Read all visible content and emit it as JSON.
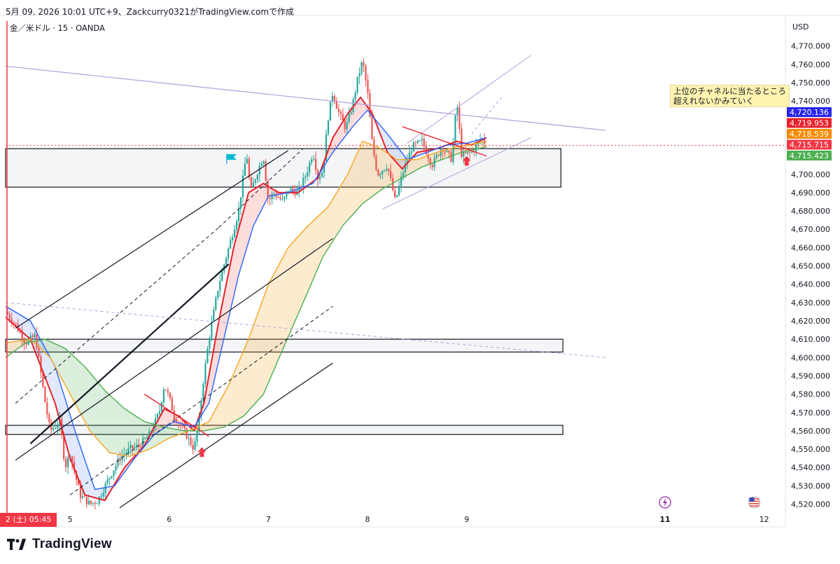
{
  "header": {
    "title": "5月 09, 2026 10:01 UTC+9、Zackcurry0321がTradingView.comで作成"
  },
  "symbol": {
    "label": "金／米ドル · 15 · OANDA"
  },
  "currency": "USD",
  "annotation": {
    "line1": "上位のチャネルに当たるところ",
    "line2": "超えれないかみていく"
  },
  "timeline_label": "2 (土)  05:45",
  "brand": {
    "name": "TradingView"
  },
  "colors": {
    "price_up": "#26a69a",
    "price_down": "#ef5350",
    "ma_red": "#e8212b",
    "ma_blue": "#2962ff",
    "ma_orange": "#f5a623",
    "ma_green": "#4caf50",
    "tag_blue": "#2a25e8",
    "tag_red": "#e8212b",
    "tag_orange": "#f58b00",
    "tag_pink": "#f23645",
    "tag_green": "#4caf50"
  },
  "chart_data": {
    "type": "line",
    "title": "金／米ドル · 15 · OANDA",
    "xlabel": "",
    "ylabel": "USD",
    "ylim": [
      4516,
      4776
    ],
    "xlim": [
      4.35,
      12.2
    ],
    "y_ticks": [
      {
        "v": 4520,
        "t": "4,520.000"
      },
      {
        "v": 4530,
        "t": "4,530.000"
      },
      {
        "v": 4540,
        "t": "4,540.000"
      },
      {
        "v": 4550,
        "t": "4,550.000"
      },
      {
        "v": 4560,
        "t": "4,560.000"
      },
      {
        "v": 4570,
        "t": "4,570.000"
      },
      {
        "v": 4580,
        "t": "4,580.000"
      },
      {
        "v": 4590,
        "t": "4,590.000"
      },
      {
        "v": 4600,
        "t": "4,600.000"
      },
      {
        "v": 4610,
        "t": "4,610.000"
      },
      {
        "v": 4620,
        "t": "4,620.000"
      },
      {
        "v": 4630,
        "t": "4,630.000"
      },
      {
        "v": 4640,
        "t": "4,640.000"
      },
      {
        "v": 4650,
        "t": "4,650.000"
      },
      {
        "v": 4660,
        "t": "4,660.000"
      },
      {
        "v": 4670,
        "t": "4,670.000"
      },
      {
        "v": 4680,
        "t": "4,680.000"
      },
      {
        "v": 4690,
        "t": "4,690.000"
      },
      {
        "v": 4700,
        "t": "4,700.000"
      },
      {
        "v": 4740,
        "t": "4,740.000"
      },
      {
        "v": 4750,
        "t": "4,750.000"
      },
      {
        "v": 4760,
        "t": "4,760.000"
      },
      {
        "v": 4770,
        "t": "4,770.000"
      }
    ],
    "x_ticks": [
      {
        "v": 5,
        "t": "5"
      },
      {
        "v": 6,
        "t": "6"
      },
      {
        "v": 7,
        "t": "7"
      },
      {
        "v": 8,
        "t": "8"
      },
      {
        "v": 9,
        "t": "9"
      },
      {
        "v": 11,
        "t": "11"
      },
      {
        "v": 12,
        "t": "12"
      }
    ],
    "price_tags": [
      {
        "v": 4720.136,
        "t": "4,720.136",
        "color": "#2a25e8"
      },
      {
        "v": 4719.953,
        "t": "4,719.953",
        "color": "#e8212b"
      },
      {
        "v": 4718.539,
        "t": "4,718.539",
        "color": "#f58b00"
      },
      {
        "v": 4715.715,
        "t": "4,715.715",
        "color": "#f23645"
      },
      {
        "v": 4715.423,
        "t": "4,715.423",
        "color": "#4caf50"
      }
    ],
    "price_path": [
      [
        4.35,
        4625
      ],
      [
        4.45,
        4618
      ],
      [
        4.55,
        4608
      ],
      [
        4.65,
        4612
      ],
      [
        4.75,
        4575
      ],
      [
        4.8,
        4560
      ],
      [
        4.9,
        4565
      ],
      [
        4.95,
        4540
      ],
      [
        5.0,
        4548
      ],
      [
        5.1,
        4525
      ],
      [
        5.2,
        4520
      ],
      [
        5.28,
        4522
      ],
      [
        5.4,
        4535
      ],
      [
        5.5,
        4545
      ],
      [
        5.6,
        4550
      ],
      [
        5.7,
        4552
      ],
      [
        5.8,
        4558
      ],
      [
        5.9,
        4570
      ],
      [
        5.95,
        4585
      ],
      [
        6.0,
        4578
      ],
      [
        6.05,
        4568
      ],
      [
        6.15,
        4560
      ],
      [
        6.25,
        4550
      ],
      [
        6.3,
        4565
      ],
      [
        6.35,
        4590
      ],
      [
        6.4,
        4610
      ],
      [
        6.45,
        4625
      ],
      [
        6.5,
        4640
      ],
      [
        6.55,
        4650
      ],
      [
        6.6,
        4660
      ],
      [
        6.65,
        4670
      ],
      [
        6.7,
        4680
      ],
      [
        6.75,
        4700
      ],
      [
        6.78,
        4712
      ],
      [
        6.82,
        4690
      ],
      [
        6.88,
        4700
      ],
      [
        6.95,
        4710
      ],
      [
        7.0,
        4685
      ],
      [
        7.05,
        4690
      ],
      [
        7.15,
        4685
      ],
      [
        7.2,
        4692
      ],
      [
        7.3,
        4690
      ],
      [
        7.38,
        4700
      ],
      [
        7.45,
        4712
      ],
      [
        7.5,
        4698
      ],
      [
        7.55,
        4702
      ],
      [
        7.6,
        4730
      ],
      [
        7.65,
        4745
      ],
      [
        7.7,
        4735
      ],
      [
        7.78,
        4725
      ],
      [
        7.85,
        4738
      ],
      [
        7.9,
        4752
      ],
      [
        7.95,
        4762
      ],
      [
        8.0,
        4745
      ],
      [
        8.05,
        4715
      ],
      [
        8.1,
        4700
      ],
      [
        8.2,
        4705
      ],
      [
        8.28,
        4685
      ],
      [
        8.35,
        4700
      ],
      [
        8.45,
        4715
      ],
      [
        8.55,
        4718
      ],
      [
        8.65,
        4705
      ],
      [
        8.75,
        4715
      ],
      [
        8.85,
        4708
      ],
      [
        8.9,
        4740
      ],
      [
        8.95,
        4710
      ],
      [
        9.05,
        4712
      ],
      [
        9.15,
        4720
      ],
      [
        9.2,
        4716
      ]
    ],
    "series": [
      {
        "name": "",
        "color": "#e8212b",
        "values": [
          [
            4.35,
            4622
          ],
          [
            4.6,
            4610
          ],
          [
            4.85,
            4575
          ],
          [
            5.0,
            4545
          ],
          [
            5.15,
            4525
          ],
          [
            5.35,
            4522
          ],
          [
            5.55,
            4540
          ],
          [
            5.75,
            4552
          ],
          [
            5.95,
            4572
          ],
          [
            6.1,
            4568
          ],
          [
            6.25,
            4560
          ],
          [
            6.35,
            4575
          ],
          [
            6.5,
            4620
          ],
          [
            6.65,
            4660
          ],
          [
            6.8,
            4690
          ],
          [
            6.95,
            4695
          ],
          [
            7.1,
            4690
          ],
          [
            7.3,
            4690
          ],
          [
            7.5,
            4698
          ],
          [
            7.65,
            4720
          ],
          [
            7.8,
            4733
          ],
          [
            7.93,
            4742
          ],
          [
            8.05,
            4733
          ],
          [
            8.2,
            4712
          ],
          [
            8.35,
            4703
          ],
          [
            8.5,
            4712
          ],
          [
            8.7,
            4714
          ],
          [
            8.9,
            4718
          ],
          [
            9.05,
            4716
          ],
          [
            9.2,
            4720
          ]
        ]
      },
      {
        "name": "",
        "color": "#2962ff",
        "values": [
          [
            4.35,
            4628
          ],
          [
            4.6,
            4620
          ],
          [
            4.85,
            4595
          ],
          [
            5.05,
            4560
          ],
          [
            5.25,
            4528
          ],
          [
            5.45,
            4530
          ],
          [
            5.65,
            4545
          ],
          [
            5.85,
            4558
          ],
          [
            6.05,
            4565
          ],
          [
            6.25,
            4562
          ],
          [
            6.4,
            4575
          ],
          [
            6.55,
            4610
          ],
          [
            6.7,
            4645
          ],
          [
            6.85,
            4672
          ],
          [
            7.0,
            4688
          ],
          [
            7.2,
            4690
          ],
          [
            7.45,
            4695
          ],
          [
            7.65,
            4712
          ],
          [
            7.85,
            4726
          ],
          [
            8.0,
            4735
          ],
          [
            8.2,
            4722
          ],
          [
            8.4,
            4708
          ],
          [
            8.6,
            4712
          ],
          [
            8.8,
            4716
          ],
          [
            9.0,
            4717
          ],
          [
            9.2,
            4720
          ]
        ]
      },
      {
        "name": "",
        "color": "#f5a623",
        "values": [
          [
            4.35,
            4608
          ],
          [
            4.6,
            4610
          ],
          [
            4.8,
            4600
          ],
          [
            5.0,
            4580
          ],
          [
            5.2,
            4560
          ],
          [
            5.4,
            4548
          ],
          [
            5.6,
            4546
          ],
          [
            5.8,
            4550
          ],
          [
            6.0,
            4556
          ],
          [
            6.2,
            4560
          ],
          [
            6.4,
            4565
          ],
          [
            6.6,
            4585
          ],
          [
            6.8,
            4610
          ],
          [
            7.0,
            4640
          ],
          [
            7.2,
            4660
          ],
          [
            7.4,
            4672
          ],
          [
            7.6,
            4682
          ],
          [
            7.8,
            4700
          ],
          [
            7.95,
            4718
          ],
          [
            8.1,
            4715
          ],
          [
            8.3,
            4708
          ],
          [
            8.5,
            4708
          ],
          [
            8.7,
            4712
          ],
          [
            8.9,
            4715
          ],
          [
            9.2,
            4718
          ]
        ]
      },
      {
        "name": "",
        "color": "#4caf50",
        "values": [
          [
            4.35,
            4600
          ],
          [
            4.55,
            4608
          ],
          [
            4.75,
            4610
          ],
          [
            4.95,
            4605
          ],
          [
            5.15,
            4595
          ],
          [
            5.35,
            4582
          ],
          [
            5.55,
            4572
          ],
          [
            5.75,
            4565
          ],
          [
            5.95,
            4562
          ],
          [
            6.15,
            4560
          ],
          [
            6.35,
            4560
          ],
          [
            6.55,
            4562
          ],
          [
            6.75,
            4568
          ],
          [
            6.95,
            4580
          ],
          [
            7.15,
            4605
          ],
          [
            7.35,
            4630
          ],
          [
            7.55,
            4655
          ],
          [
            7.75,
            4672
          ],
          [
            7.95,
            4684
          ],
          [
            8.15,
            4692
          ],
          [
            8.35,
            4698
          ],
          [
            8.55,
            4704
          ],
          [
            8.75,
            4708
          ],
          [
            8.95,
            4712
          ],
          [
            9.2,
            4715
          ]
        ]
      }
    ],
    "zones": [
      {
        "x1": 4.35,
        "x2": 9.95,
        "y1": 4693,
        "y2": 4714
      },
      {
        "x1": 4.35,
        "x2": 9.97,
        "y1": 4603,
        "y2": 4610
      },
      {
        "x1": 4.35,
        "x2": 9.97,
        "y1": 4558,
        "y2": 4563
      }
    ],
    "lines": [
      {
        "x1": 4.45,
        "y1": 4544,
        "x2": 7.65,
        "y2": 4665,
        "color": "#131722",
        "w": 1.2,
        "dash": ""
      },
      {
        "x1": 4.6,
        "y1": 4553,
        "x2": 6.6,
        "y2": 4651,
        "color": "#131722",
        "w": 2.2,
        "dash": ""
      },
      {
        "x1": 4.45,
        "y1": 4575,
        "x2": 6.5,
        "y2": 4671,
        "color": "#131722",
        "w": 1,
        "dash": "5,4"
      },
      {
        "x1": 6.5,
        "y1": 4671,
        "x2": 7.35,
        "y2": 4714,
        "color": "#131722",
        "w": 1,
        "dash": "5,4"
      },
      {
        "x1": 4.45,
        "y1": 4616,
        "x2": 7.2,
        "y2": 4713,
        "color": "#131722",
        "w": 1.2,
        "dash": ""
      },
      {
        "x1": 5.0,
        "y1": 4525,
        "x2": 7.65,
        "y2": 4628,
        "color": "#131722",
        "w": 1,
        "dash": "5,4"
      },
      {
        "x1": 5.5,
        "y1": 4518,
        "x2": 7.65,
        "y2": 4597,
        "color": "#131722",
        "w": 1.2,
        "dash": ""
      },
      {
        "x1": 4.35,
        "y1": 4759,
        "x2": 10.4,
        "y2": 4724,
        "color": "#b39ddb",
        "w": 1.2,
        "dash": ""
      },
      {
        "x1": 4.35,
        "y1": 4630,
        "x2": 10.4,
        "y2": 4600,
        "color": "#b39ddb",
        "w": 1,
        "dash": "4,4"
      },
      {
        "x1": 8.15,
        "y1": 4681,
        "x2": 9.65,
        "y2": 4720,
        "color": "#b39ddb",
        "w": 1,
        "dash": ""
      },
      {
        "x1": 8.4,
        "y1": 4717,
        "x2": 9.65,
        "y2": 4765,
        "color": "#b39ddb",
        "w": 1,
        "dash": ""
      },
      {
        "x1": 9.05,
        "y1": 4722,
        "x2": 9.35,
        "y2": 4742,
        "color": "#b39ddb",
        "w": 1,
        "dash": "4,4"
      },
      {
        "x1": 8.35,
        "y1": 4726,
        "x2": 9.2,
        "y2": 4710,
        "color": "#e8212b",
        "w": 1.4,
        "dash": ""
      },
      {
        "x1": 5.75,
        "y1": 4580,
        "x2": 6.4,
        "y2": 4557,
        "color": "#e8212b",
        "w": 1.4,
        "dash": ""
      }
    ],
    "arrows": [
      {
        "x": 6.33,
        "y": 4548
      },
      {
        "x": 9.0,
        "y": 4707
      }
    ],
    "flag": {
      "x": 6.58,
      "y": 4711
    }
  }
}
